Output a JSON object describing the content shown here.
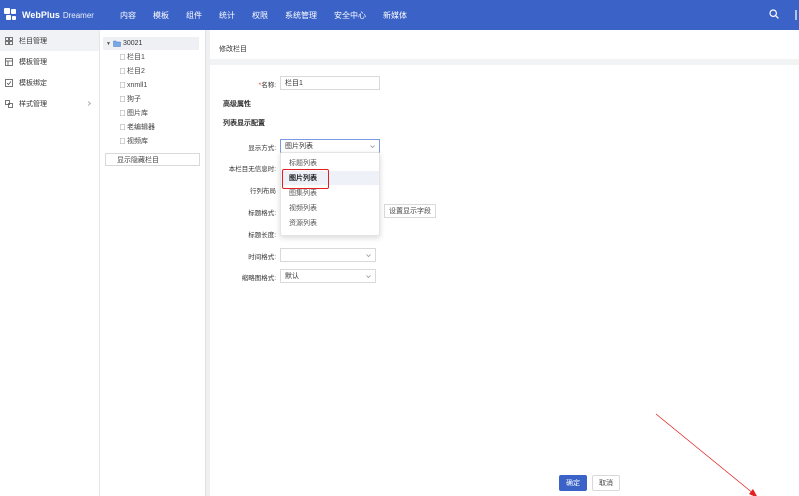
{
  "app": {
    "name": "WebPlus",
    "suffix": "Dreamer",
    "brand_color": "#3a62c7"
  },
  "nav": [
    "内容",
    "模板",
    "组件",
    "统计",
    "权限",
    "系统管理",
    "安全中心",
    "新媒体"
  ],
  "sidebar": {
    "items": [
      {
        "label": "栏目管理",
        "icon": "column-icon"
      },
      {
        "label": "模板管理",
        "icon": "template-icon"
      },
      {
        "label": "模板绑定",
        "icon": "bind-icon"
      },
      {
        "label": "样式管理",
        "icon": "style-icon"
      }
    ]
  },
  "tree": {
    "root": "30021",
    "children": [
      "栏目1",
      "栏目2",
      "xnmll1",
      "狗子",
      "图片库",
      "老编辑器",
      "视频库"
    ],
    "toggle": "显示隐藏栏目"
  },
  "panel": {
    "title": "修改栏目"
  },
  "form": {
    "name_label": "名称:",
    "name_value": "栏目1",
    "advanced": "高级属性",
    "list_config": "列表显示配置",
    "display_label": "显示方式:",
    "display_value": "图片列表",
    "no_info_label": "本栏目无信息时:",
    "layout_label": "行列布局",
    "title_format_label": "标题格式:",
    "set_fields_button": "设置显示字段",
    "title_length_label": "标题长度:",
    "time_format_label": "时间格式:",
    "thumb_format_label": "缩略图格式:",
    "thumb_format_value": "默认"
  },
  "dropdown": {
    "options": [
      "标题列表",
      "图片列表",
      "图集列表",
      "视频列表",
      "资源列表"
    ],
    "selected_index": 1,
    "highlight_color": "#e32020"
  },
  "actions": {
    "ok": "确定",
    "cancel": "取消"
  }
}
